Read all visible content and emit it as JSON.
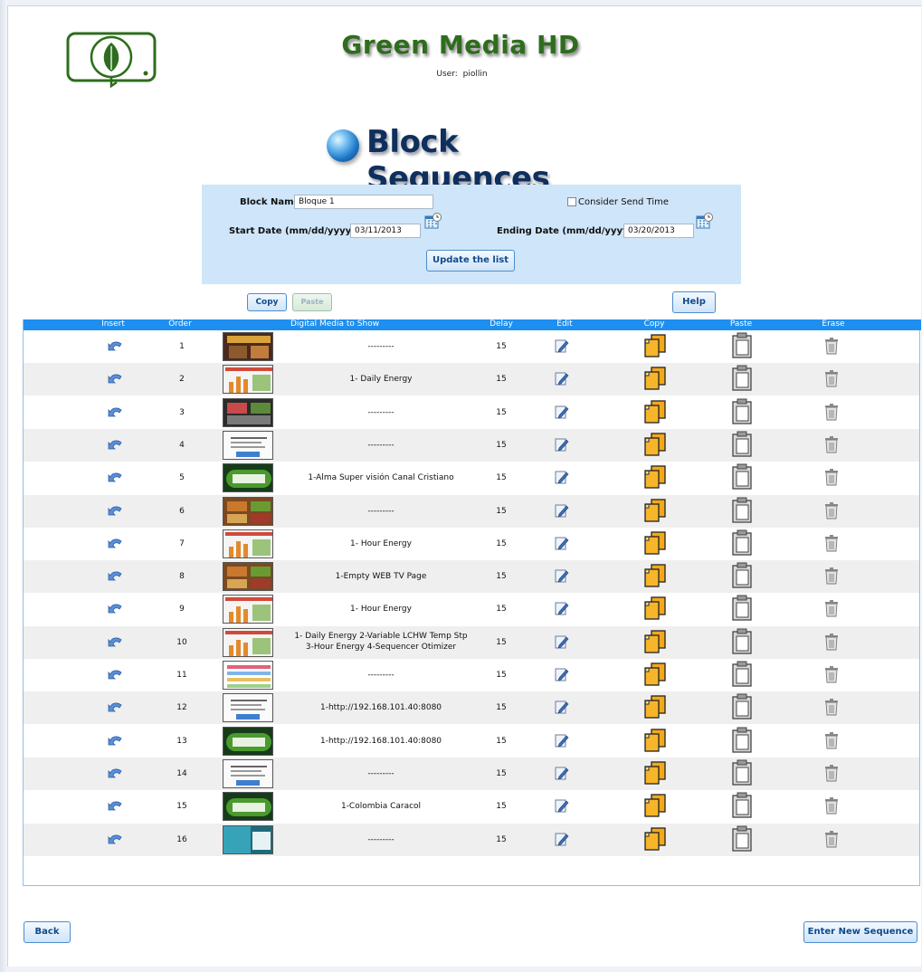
{
  "header": {
    "brand": "Green Media HD",
    "user_label": "User:",
    "user_name": "piollin",
    "page_title": "Block Sequences"
  },
  "filter": {
    "block_name_label": "Block Name:",
    "block_name_value": "Bloque 1",
    "consider_send_time_label": "Consider Send Time",
    "start_date_label": "Start Date (mm/dd/yyyy):",
    "start_date_value": "03/11/2013",
    "end_date_label": "Ending Date (mm/dd/yyyy):",
    "end_date_value": "03/20/2013",
    "update_button": "Update the list"
  },
  "toolbar": {
    "copy_label": "Copy",
    "paste_label": "Paste",
    "help_label": "Help"
  },
  "table": {
    "columns": [
      "Insert",
      "Order",
      "Digital Media to Show",
      "Delay",
      "Edit",
      "Copy",
      "Paste",
      "Erase"
    ],
    "rows": [
      {
        "order": "1",
        "media": "---------",
        "delay": "15",
        "thumb": "poster"
      },
      {
        "order": "2",
        "media": "1- Daily Energy",
        "delay": "15",
        "thumb": "chart"
      },
      {
        "order": "3",
        "media": "---------",
        "delay": "15",
        "thumb": "dark"
      },
      {
        "order": "4",
        "media": "---------",
        "delay": "15",
        "thumb": "doc"
      },
      {
        "order": "5",
        "media": "1-Alma Super visión Canal Cristiano",
        "delay": "15",
        "thumb": "webtv"
      },
      {
        "order": "6",
        "media": "---------",
        "delay": "15",
        "thumb": "food"
      },
      {
        "order": "7",
        "media": "1- Hour Energy",
        "delay": "15",
        "thumb": "chart"
      },
      {
        "order": "8",
        "media": "1-Empty WEB TV Page",
        "delay": "15",
        "thumb": "food"
      },
      {
        "order": "9",
        "media": "1- Hour Energy",
        "delay": "15",
        "thumb": "chart"
      },
      {
        "order": "10",
        "media": "1- Daily Energy 2-Variable LCHW Temp Stp",
        "media2": "3-Hour Energy 4-Sequencer Otimizer",
        "delay": "15",
        "thumb": "chart"
      },
      {
        "order": "11",
        "media": "---------",
        "delay": "15",
        "thumb": "list"
      },
      {
        "order": "12",
        "media": "1-http://192.168.101.40:8080",
        "delay": "15",
        "thumb": "doc"
      },
      {
        "order": "13",
        "media": "1-http://192.168.101.40:8080",
        "delay": "15",
        "thumb": "webtv"
      },
      {
        "order": "14",
        "media": "---------",
        "delay": "15",
        "thumb": "doc"
      },
      {
        "order": "15",
        "media": "1-Colombia Caracol",
        "delay": "15",
        "thumb": "webtv"
      },
      {
        "order": "16",
        "media": "---------",
        "delay": "15",
        "thumb": "teal"
      }
    ]
  },
  "footer": {
    "back_label": "Back",
    "new_sequence_label": "Enter New Sequence"
  },
  "icons": {
    "insert": "insert-arrow-icon",
    "edit": "edit-pencil-icon",
    "copy": "copy-pages-icon",
    "paste": "paste-clipboard-icon",
    "erase": "trash-bin-icon",
    "calendar": "calendar-icon",
    "globe": "globe-icon",
    "logo": "leaf-monitor-logo"
  },
  "colors": {
    "brand_green": "#2e6d1d",
    "header_blue": "#1e8ff0",
    "panel_blue": "#cfe5f9",
    "title_navy": "#0f2f5e"
  }
}
